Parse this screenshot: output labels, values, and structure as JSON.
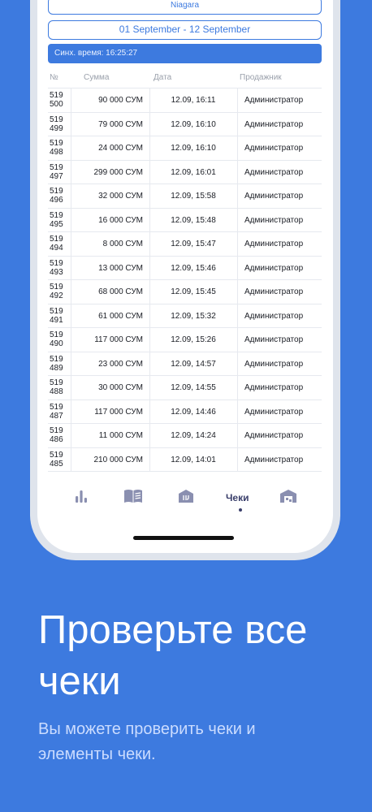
{
  "filters": {
    "store": "Niagara",
    "date_range": "01 September - 12 September"
  },
  "sync": {
    "label": "Синх. время: 16:25:27"
  },
  "table": {
    "headers": {
      "num": "№",
      "sum": "Сумма",
      "date": "Дата",
      "seller": "Продажник"
    },
    "rows": [
      {
        "num_top": "519",
        "num_bottom": "500",
        "sum": "90 000 СУМ",
        "date": "12.09, 16:11",
        "seller": "Администратор"
      },
      {
        "num_top": "519",
        "num_bottom": "499",
        "sum": "79 000 СУМ",
        "date": "12.09, 16:10",
        "seller": "Администратор"
      },
      {
        "num_top": "519",
        "num_bottom": "498",
        "sum": "24 000 СУМ",
        "date": "12.09, 16:10",
        "seller": "Администратор"
      },
      {
        "num_top": "519",
        "num_bottom": "497",
        "sum": "299 000 СУМ",
        "date": "12.09, 16:01",
        "seller": "Администратор"
      },
      {
        "num_top": "519",
        "num_bottom": "496",
        "sum": "32 000 СУМ",
        "date": "12.09, 15:58",
        "seller": "Администратор"
      },
      {
        "num_top": "519",
        "num_bottom": "495",
        "sum": "16 000 СУМ",
        "date": "12.09, 15:48",
        "seller": "Администратор"
      },
      {
        "num_top": "519",
        "num_bottom": "494",
        "sum": "8 000 СУМ",
        "date": "12.09, 15:47",
        "seller": "Администратор"
      },
      {
        "num_top": "519",
        "num_bottom": "493",
        "sum": "13 000 СУМ",
        "date": "12.09, 15:46",
        "seller": "Администратор"
      },
      {
        "num_top": "519",
        "num_bottom": "492",
        "sum": "68 000 СУМ",
        "date": "12.09, 15:45",
        "seller": "Администратор"
      },
      {
        "num_top": "519",
        "num_bottom": "491",
        "sum": "61 000 СУМ",
        "date": "12.09, 15:32",
        "seller": "Администратор"
      },
      {
        "num_top": "519",
        "num_bottom": "490",
        "sum": "117 000 СУМ",
        "date": "12.09, 15:26",
        "seller": "Администратор"
      },
      {
        "num_top": "519",
        "num_bottom": "489",
        "sum": "23 000 СУМ",
        "date": "12.09, 14:57",
        "seller": "Администратор"
      },
      {
        "num_top": "519",
        "num_bottom": "488",
        "sum": "30 000 СУМ",
        "date": "12.09, 14:55",
        "seller": "Администратор"
      },
      {
        "num_top": "519",
        "num_bottom": "487",
        "sum": "117 000 СУМ",
        "date": "12.09, 14:46",
        "seller": "Администратор"
      },
      {
        "num_top": "519",
        "num_bottom": "486",
        "sum": "11 000 СУМ",
        "date": "12.09, 14:24",
        "seller": "Администратор"
      },
      {
        "num_top": "519",
        "num_bottom": "485",
        "sum": "210 000 СУМ",
        "date": "12.09, 14:01",
        "seller": "Администратор"
      }
    ]
  },
  "tabbar": {
    "items": [
      {
        "icon": "bar-chart-icon",
        "label": ""
      },
      {
        "icon": "book-icon",
        "label": ""
      },
      {
        "icon": "store-icon",
        "label": ""
      },
      {
        "icon": "",
        "label": "Чеки",
        "active": true
      },
      {
        "icon": "warehouse-icon",
        "label": ""
      }
    ]
  },
  "promo": {
    "headline_line1": "Проверьте все",
    "headline_line2": "чеки",
    "sub_line1": "Вы можете проверить чеки  и",
    "sub_line2": "элементы чеки."
  },
  "colors": {
    "background": "#3d7adf",
    "accent": "#3d7adf",
    "tab_active": "#3a3f6b",
    "tab_icon": "#8a8fb0"
  }
}
